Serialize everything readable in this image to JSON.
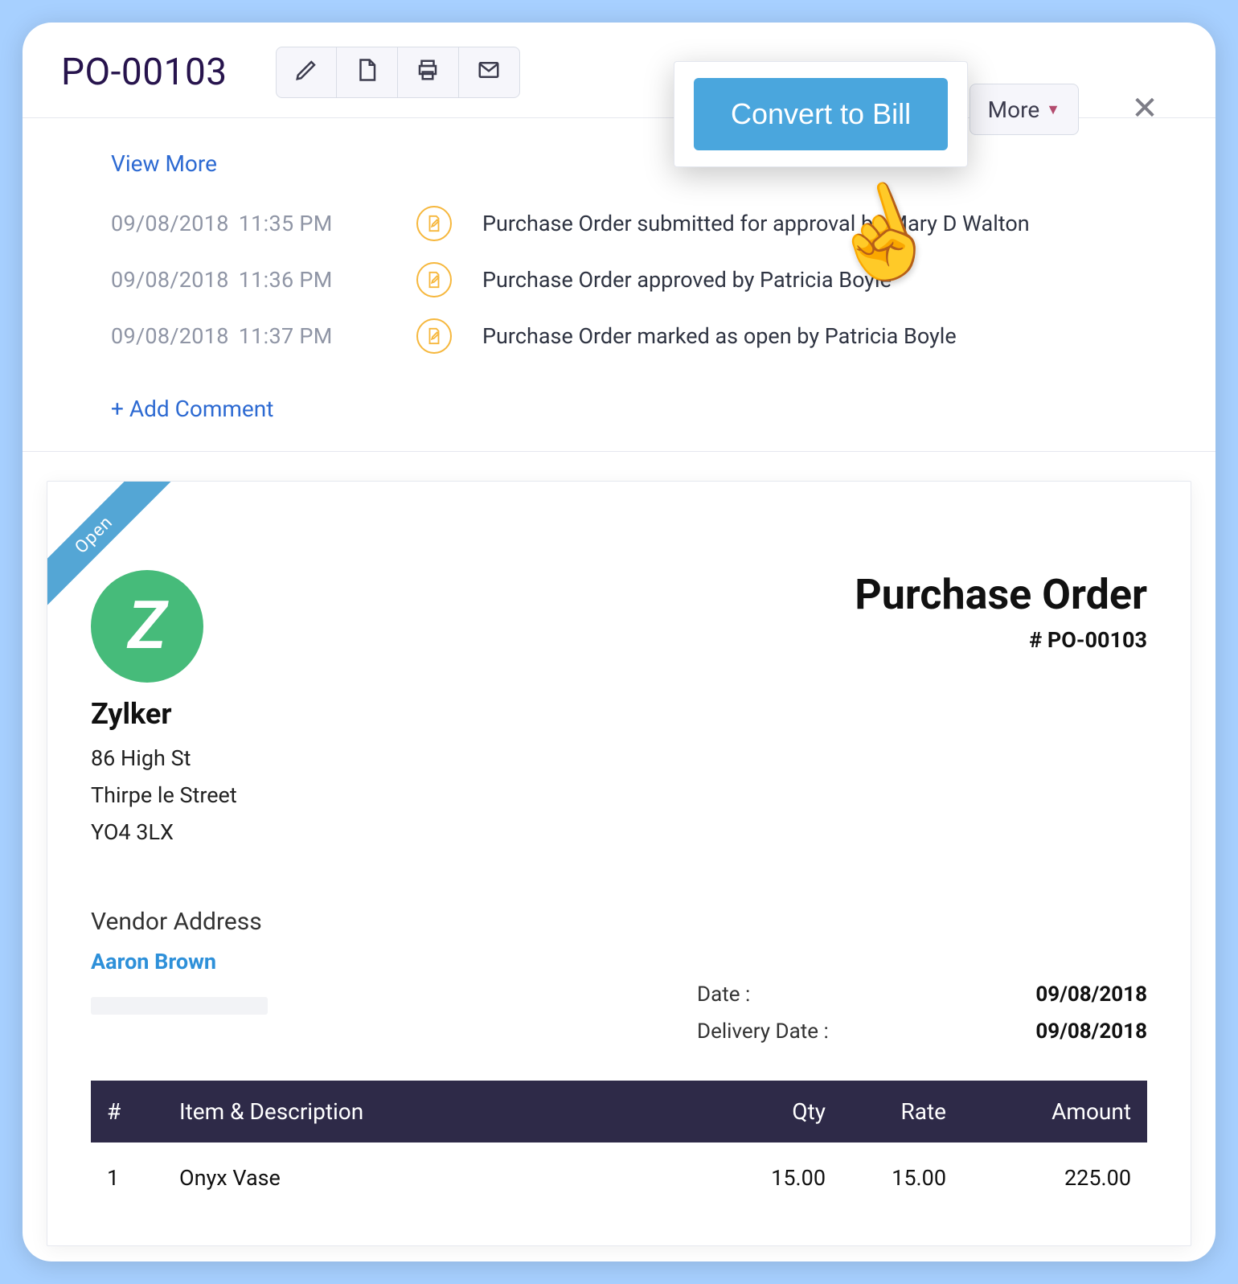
{
  "header": {
    "title": "PO-00103",
    "convert_label": "Convert to Bill",
    "more_label": "More",
    "close_symbol": "✕"
  },
  "history": {
    "view_more": "View More",
    "add_comment": "+  Add Comment",
    "items": [
      {
        "date": "09/08/2018",
        "time": "11:35 PM",
        "text": "Purchase Order submitted for approval by Mary D Walton"
      },
      {
        "date": "09/08/2018",
        "time": "11:36 PM",
        "text": "Purchase Order approved by Patricia Boyle"
      },
      {
        "date": "09/08/2018",
        "time": "11:37 PM",
        "text": "Purchase Order marked as open by Patricia Boyle"
      }
    ]
  },
  "doc": {
    "ribbon": "Open",
    "logo_letter": "Z",
    "company": {
      "name": "Zylker",
      "line1": "86 High St",
      "line2": "Thirpe le Street",
      "line3": "YO4 3LX"
    },
    "title": "Purchase Order",
    "number": "# PO-00103",
    "vendor_heading": "Vendor Address",
    "vendor_name": "Aaron Brown",
    "dates": {
      "date_label": "Date :",
      "date_value": "09/08/2018",
      "delivery_label": "Delivery Date :",
      "delivery_value": "09/08/2018"
    },
    "table": {
      "headers": {
        "num": "#",
        "desc": "Item & Description",
        "qty": "Qty",
        "rate": "Rate",
        "amount": "Amount"
      },
      "rows": [
        {
          "num": "1",
          "desc": "Onyx Vase",
          "qty": "15.00",
          "rate": "15.00",
          "amount": "225.00"
        }
      ]
    }
  }
}
